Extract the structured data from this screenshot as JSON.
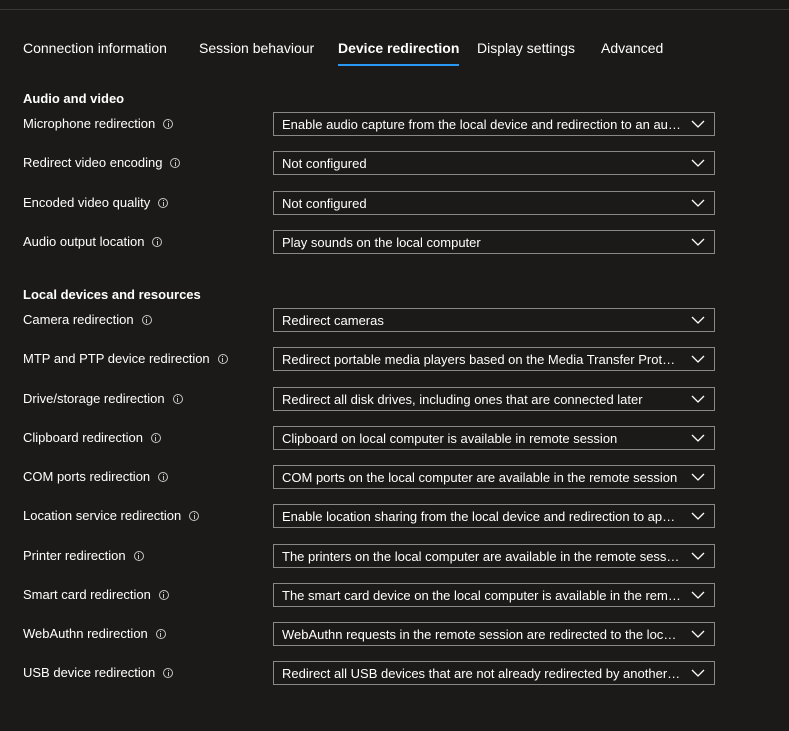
{
  "tabs": [
    {
      "label": "Connection information",
      "active": false
    },
    {
      "label": "Session behaviour",
      "active": false
    },
    {
      "label": "Device redirection",
      "active": true
    },
    {
      "label": "Display settings",
      "active": false
    },
    {
      "label": "Advanced",
      "active": false
    }
  ],
  "sections": {
    "audio_video": {
      "title": "Audio and video",
      "rows": [
        {
          "label": "Microphone redirection",
          "value": "Enable audio capture from the local device and redirection to an audio application in the remote session"
        },
        {
          "label": "Redirect video encoding",
          "value": "Not configured"
        },
        {
          "label": "Encoded video quality",
          "value": "Not configured"
        },
        {
          "label": "Audio output location",
          "value": "Play sounds on the local computer"
        }
      ]
    },
    "local_devices": {
      "title": "Local devices and resources",
      "rows": [
        {
          "label": "Camera redirection",
          "value": "Redirect cameras"
        },
        {
          "label": "MTP and PTP device redirection",
          "value": "Redirect portable media players based on the Media Transfer Protocol (MTP) and digital cameras based on the Picture Transfer Protocol (PTP)"
        },
        {
          "label": "Drive/storage redirection",
          "value": "Redirect all disk drives, including ones that are connected later"
        },
        {
          "label": "Clipboard redirection",
          "value": "Clipboard on local computer is available in remote session"
        },
        {
          "label": "COM ports redirection",
          "value": "COM ports on the local computer are available in the remote session"
        },
        {
          "label": "Location service redirection",
          "value": "Enable location sharing from the local device and redirection to apps in the remote session"
        },
        {
          "label": "Printer redirection",
          "value": "The printers on the local computer are available in the remote session"
        },
        {
          "label": "Smart card redirection",
          "value": "The smart card device on the local computer is available in the remote session"
        },
        {
          "label": "WebAuthn redirection",
          "value": "WebAuthn requests in the remote session are redirected to the local computer"
        },
        {
          "label": "USB device redirection",
          "value": "Redirect all USB devices that are not already redirected by another high-level redirection"
        }
      ]
    }
  },
  "icons": {
    "info": "info-icon",
    "dropdown": "chevron-down-icon"
  },
  "colors": {
    "background": "#1b1a19",
    "accent": "#2899f5",
    "border": "#8a8886"
  }
}
